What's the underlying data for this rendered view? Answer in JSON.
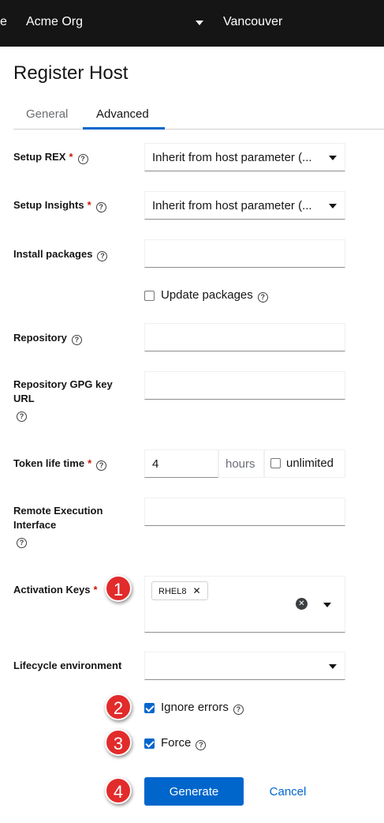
{
  "topbar": {
    "prev_fragment": "e",
    "organization": "Acme Org",
    "location": "Vancouver"
  },
  "page_title": "Register Host",
  "tabs": [
    {
      "label": "General",
      "active": false
    },
    {
      "label": "Advanced",
      "active": true
    }
  ],
  "fields": {
    "setup_rex": {
      "label": "Setup REX",
      "required": true,
      "value": "Inherit from host parameter (..."
    },
    "setup_insights": {
      "label": "Setup Insights",
      "required": true,
      "value": "Inherit from host parameter (..."
    },
    "install_packages": {
      "label": "Install packages",
      "value": ""
    },
    "update_packages": {
      "label": "Update packages",
      "checked": false
    },
    "repository": {
      "label": "Repository",
      "value": ""
    },
    "repository_gpg_key_url": {
      "label_line1": "Repository GPG key",
      "label_line2": "URL",
      "value": ""
    },
    "token_life_time": {
      "label": "Token life time",
      "required": true,
      "value": "4",
      "unit": "hours",
      "unlimited_label": "unlimited",
      "unlimited_checked": false
    },
    "remote_execution_interface": {
      "label_line1": "Remote Execution",
      "label_line2": "Interface",
      "value": ""
    },
    "activation_keys": {
      "label": "Activation Keys",
      "required": true,
      "chips": [
        "RHEL8"
      ]
    },
    "lifecycle_environment": {
      "label": "Lifecycle environment",
      "value": ""
    },
    "ignore_errors": {
      "label": "Ignore errors",
      "checked": true
    },
    "force": {
      "label": "Force",
      "checked": true
    }
  },
  "required_marker": "*",
  "help_glyph": "?",
  "chip_remove_glyph": "✕",
  "clear_glyph": "✕",
  "buttons": {
    "generate": "Generate",
    "cancel": "Cancel"
  },
  "annotations": [
    "1",
    "2",
    "3",
    "4"
  ],
  "colors": {
    "topbar_bg": "#151515",
    "primary": "#0066cc",
    "required": "#c9190b",
    "annotation_badge": "#e22b2b"
  }
}
